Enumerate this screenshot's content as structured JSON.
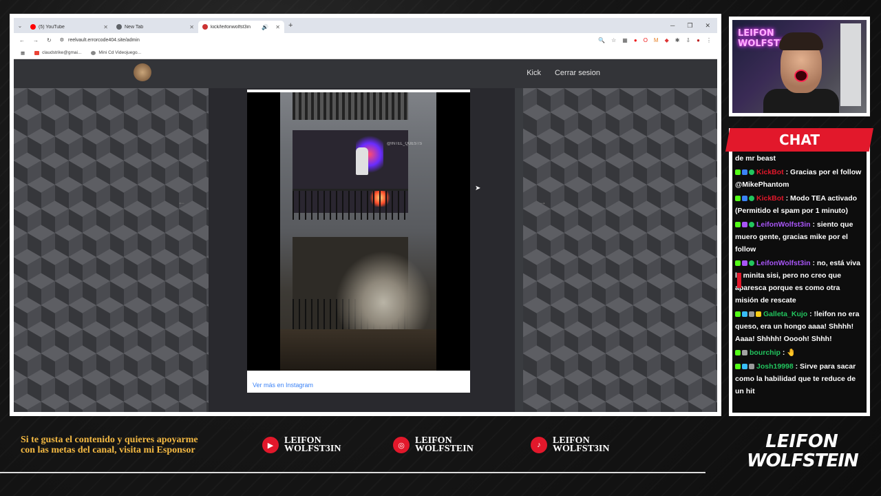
{
  "browser": {
    "tabs": [
      {
        "label": "(5) YouTube",
        "color": "#ff0000",
        "active": false
      },
      {
        "label": "New Tab",
        "color": "#5f6368",
        "active": false
      },
      {
        "label": "kick/leifonwolfst3in",
        "color": "#c33",
        "active": true
      }
    ],
    "new_tab_glyph": "+",
    "url": "reelvault.errorcode404.site/admin",
    "bookmarks": [
      {
        "label": "claudstrike@gmai...",
        "color": "#ea4335"
      },
      {
        "label": "Mini Cd Videojuego...",
        "color": "#888"
      }
    ]
  },
  "site": {
    "nav": [
      "Kick",
      "Cerrar sesion"
    ],
    "embed_link": "Ver más en Instagram",
    "watermark": "@INTEL_QUESTS",
    "prev_arrow": "←",
    "next_arrow": "→"
  },
  "webcam": {
    "neon_line1": "LEIFON",
    "neon_line2": "WOLFSTEIN"
  },
  "chat": {
    "title": "CHAT",
    "messages": [
      {
        "user": "",
        "user_color": "#fff",
        "text": "de mr beast"
      },
      {
        "user": "KickBot",
        "user_color": "#e2182b",
        "text": ": Gracias por el follow @MikePhantom"
      },
      {
        "user": "KickBot",
        "user_color": "#e2182b",
        "text": ": Modo TEA activado (Permitido el spam por 1 minuto)"
      },
      {
        "user": "LeifonWolfst3in",
        "user_color": "#a855f7",
        "text": ": siento que muero gente, gracias mike por el follow"
      },
      {
        "user": "LeifonWolfst3in",
        "user_color": "#a855f7",
        "text": ": no, está viva la minita sisi, pero no creo que aparesca porque es como otra misión de rescate"
      },
      {
        "user": "Galleta_Kujo",
        "user_color": "#22c55e",
        "text": ": !leifon no era queso, era un hongo aaaa! Shhhh! Aaaa! Shhhh! Ooooh! Shhh!"
      },
      {
        "user": "bourchip",
        "user_color": "#22c55e",
        "text": ": 🤚"
      },
      {
        "user": "Josh19998",
        "user_color": "#22c55e",
        "text": ": Sirve para sacar como la habilidad que te reduce de un hit"
      }
    ]
  },
  "footer": {
    "promo": "Si te gusta el contenido y quieres apoyarme con las metas del canal, visita mi Esponsor",
    "socials": [
      {
        "platform": "youtube-icon",
        "glyph": "▶",
        "line1": "LEIFON",
        "line2": "WOLFST3IN"
      },
      {
        "platform": "instagram-icon",
        "glyph": "◎",
        "line1": "LEIFON",
        "line2": "WOLFSTEIN"
      },
      {
        "platform": "tiktok-icon",
        "glyph": "♪",
        "line1": "LEIFON",
        "line2": "WOLFST3IN"
      }
    ],
    "brand_line1": "LEIFON",
    "brand_line2": "WOLFSTEIN"
  }
}
